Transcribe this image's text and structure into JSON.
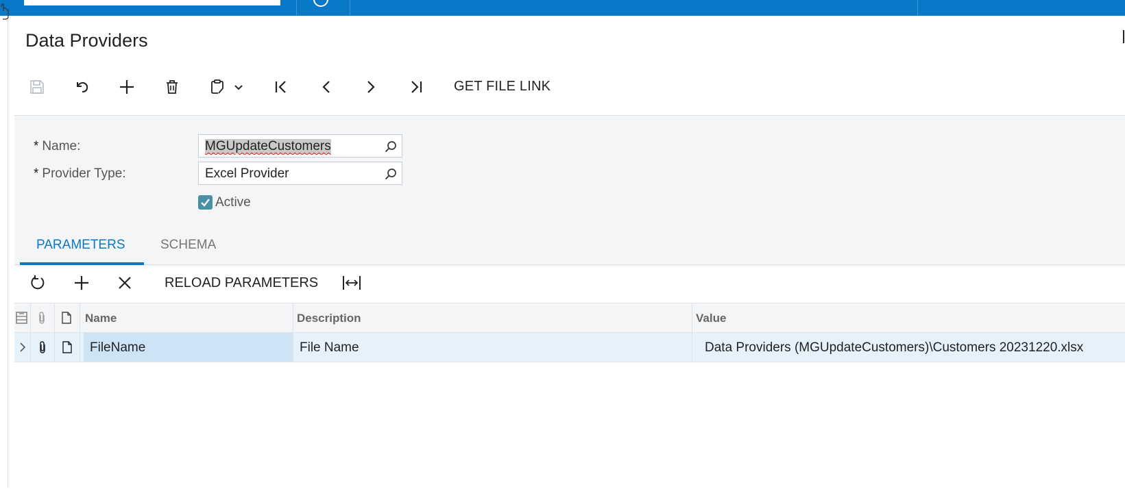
{
  "page": {
    "title": "Data Providers"
  },
  "toolbar": {
    "items": [
      {
        "name": "save",
        "icon": "save-icon",
        "enabled": false
      },
      {
        "name": "cancel",
        "icon": "undo-icon"
      },
      {
        "name": "add",
        "icon": "plus-icon"
      },
      {
        "name": "delete",
        "icon": "trash-icon"
      },
      {
        "name": "copy-paste",
        "icon": "clipboard-icon"
      },
      {
        "name": "first",
        "icon": "first-record-icon"
      },
      {
        "name": "previous",
        "icon": "previous-record-icon"
      },
      {
        "name": "next",
        "icon": "next-record-icon"
      },
      {
        "name": "last",
        "icon": "last-record-icon"
      }
    ],
    "get_file_link_label": "GET FILE LINK"
  },
  "form": {
    "name_label": "Name:",
    "name_value": "MGUpdateCustomers",
    "provider_type_label": "Provider Type:",
    "provider_type_value": "Excel Provider",
    "required_mark": "*",
    "active_label": "Active",
    "active_checked": true
  },
  "tabs": [
    {
      "label": "PARAMETERS",
      "active": true
    },
    {
      "label": "SCHEMA",
      "active": false
    }
  ],
  "grid_toolbar": {
    "refresh_icon": "refresh-icon",
    "add_icon": "plus-icon",
    "delete_icon": "close-icon",
    "reload_label": "RELOAD PARAMETERS",
    "fit_icon": "fit-columns-icon"
  },
  "grid": {
    "columns": [
      "Name",
      "Description",
      "Value"
    ],
    "rows": [
      {
        "name": "FileName",
        "description": "File Name",
        "value": "Data Providers (MGUpdateCustomers)\\Customers 20231220.xlsx"
      }
    ]
  },
  "colors": {
    "brand_blue": "#0a78c8",
    "form_background": "#f4f5f7",
    "selected_row": "#e6f2fb",
    "selected_cell": "#cde4f6",
    "checkbox": "#4a90a4"
  }
}
